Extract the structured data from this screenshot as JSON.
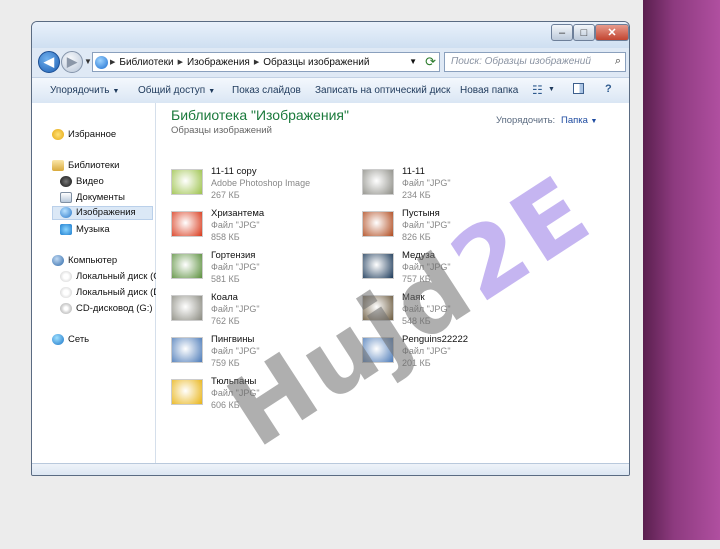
{
  "address": {
    "crumbs": [
      "Библиотеки",
      "Изображения",
      "Образцы изображений"
    ]
  },
  "search": {
    "placeholder": "Поиск: Образцы изображений"
  },
  "toolbar": {
    "organize": "Упорядочить",
    "share": "Общий доступ",
    "slideshow": "Показ слайдов",
    "burn": "Записать на оптический диск",
    "new_folder": "Новая папка",
    "help": "?"
  },
  "nav": {
    "favorites": "Избранное",
    "libraries": "Библиотеки",
    "video": "Видео",
    "documents": "Документы",
    "images": "Изображения",
    "music": "Музыка",
    "computer": "Компьютер",
    "local_c": "Локальный диск (C",
    "local_d": "Локальный диск (D",
    "cd": "CD-дисковод (G:)",
    "network": "Сеть"
  },
  "content": {
    "title": "Библиотека \"Изображения\"",
    "subtitle": "Образцы изображений",
    "arrange_label": "Упорядочить:",
    "arrange_value": "Папка"
  },
  "files": [
    {
      "name": "11-11 copy",
      "type": "Adobe Photoshop Image",
      "size": "267 КБ",
      "color": "#9cc24a"
    },
    {
      "name": "11-11",
      "type": "Файл \"JPG\"",
      "size": "234 КБ",
      "color": "#8d8d86"
    },
    {
      "name": "Хризантема",
      "type": "Файл \"JPG\"",
      "size": "858 КБ",
      "color": "#d8381a"
    },
    {
      "name": "Пустыня",
      "type": "Файл \"JPG\"",
      "size": "826 КБ",
      "color": "#b04a1e"
    },
    {
      "name": "Гортензия",
      "type": "Файл \"JPG\"",
      "size": "581 КБ",
      "color": "#5a8f3c"
    },
    {
      "name": "Медуза",
      "type": "Файл \"JPG\"",
      "size": "757 КБ",
      "color": "#1c3a5a"
    },
    {
      "name": "Коала",
      "type": "Файл \"JPG\"",
      "size": "762 КБ",
      "color": "#8a8a80"
    },
    {
      "name": "Маяк",
      "type": "Файл \"JPG\"",
      "size": "548 КБ",
      "color": "#6b5a3e"
    },
    {
      "name": "Пингвины",
      "type": "Файл \"JPG\"",
      "size": "759 КБ",
      "color": "#4b7ab8"
    },
    {
      "name": "Penguins22222",
      "type": "Файл \"JPG\"",
      "size": "201 КБ",
      "color": "#4b7ab8"
    },
    {
      "name": "Тюльпаны",
      "type": "Файл \"JPG\"",
      "size": "606 КБ",
      "color": "#e8b314"
    }
  ],
  "watermark": {
    "main": "Hujd",
    "accent": "2E"
  }
}
